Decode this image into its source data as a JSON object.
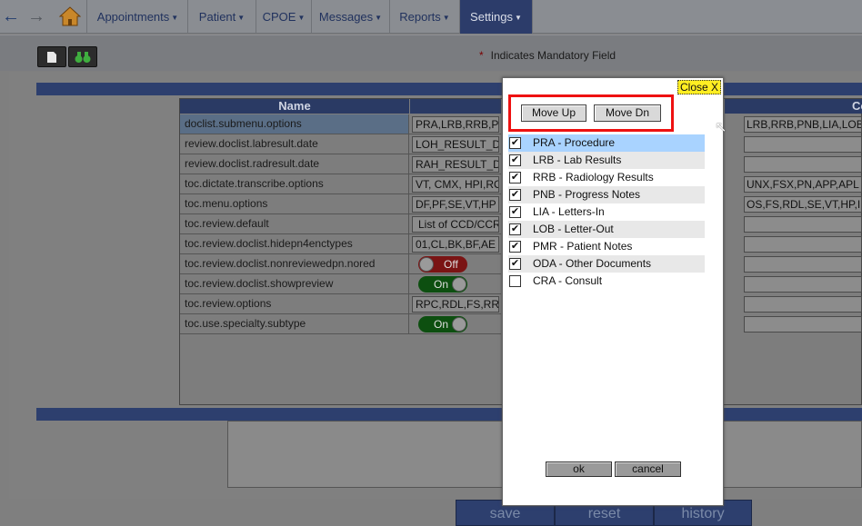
{
  "nav": {
    "menus": [
      "Appointments",
      "Patient",
      "CPOE",
      "Messages",
      "Reports",
      "Settings"
    ],
    "active_menu": "Settings"
  },
  "toolbar": {
    "mandatory_star": "*",
    "mandatory_text": "Indicates Mandatory Field"
  },
  "grid": {
    "name_header": "Name",
    "right_header": "Co",
    "rows": [
      {
        "name": "doclist.submenu.options",
        "value": "PRA,LRB,RRB,PNB,LIA,LOB,PMR,ODA",
        "right": "LRB,RRB,PNB,LIA,LOB"
      },
      {
        "name": "review.doclist.labresult.date",
        "value": "LOH_RESULT_D",
        "right": ""
      },
      {
        "name": "review.doclist.radresult.date",
        "value": "RAH_RESULT_D",
        "right": ""
      },
      {
        "name": "toc.dictate.transcribe.options",
        "value": "VT, CMX, HPI,RO",
        "right": "UNX,FSX,PN,APP,APL"
      },
      {
        "name": "toc.menu.options",
        "value": "DF,PF,SE,VT,HP",
        "right": "OS,FS,RDL,SE,VT,HP,I"
      },
      {
        "name": "toc.review.default",
        "value": "List of CCD/CCR",
        "right": ""
      },
      {
        "name": "toc.review.doclist.hidepn4enctypes",
        "value": "01,CL,BK,BF,AE",
        "right": ""
      },
      {
        "name": "toc.review.doclist.nonreviewedpn.nored",
        "toggle": "Off",
        "right": ""
      },
      {
        "name": "toc.review.doclist.showpreview",
        "toggle": "On",
        "right": ""
      },
      {
        "name": "toc.review.options",
        "value": "RPC,RDL,FS,RRU",
        "right": ""
      },
      {
        "name": "toc.use.specialty.subtype",
        "toggle": "On",
        "right": ""
      }
    ]
  },
  "dialog": {
    "close_label": "Close X",
    "move_up": "Move Up",
    "move_down": "Move Dn",
    "items": [
      {
        "label": "PRA - Procedure",
        "checked": "✔"
      },
      {
        "label": "LRB - Lab Results",
        "checked": "✔"
      },
      {
        "label": "RRB - Radiology Results",
        "checked": "✔"
      },
      {
        "label": "PNB - Progress Notes",
        "checked": "✔"
      },
      {
        "label": "LIA - Letters-In",
        "checked": "✔"
      },
      {
        "label": "LOB - Letter-Out",
        "checked": "✔"
      },
      {
        "label": "PMR - Patient Notes",
        "checked": "✔"
      },
      {
        "label": "ODA - Other Documents",
        "checked": "✔"
      },
      {
        "label": "CRA - Consult",
        "checked": ""
      }
    ],
    "ok": "ok",
    "cancel": "cancel"
  },
  "bottom": {
    "save": "save",
    "reset": "reset",
    "history": "history"
  }
}
